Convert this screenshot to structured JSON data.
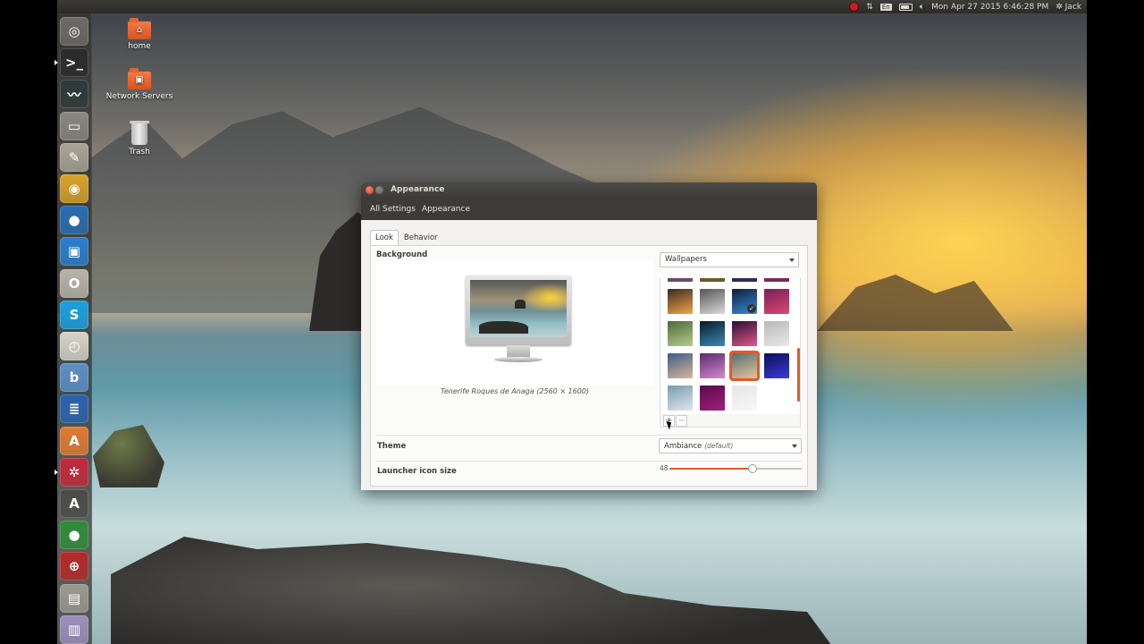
{
  "top_panel": {
    "keyboard": "En",
    "datetime": "Mon Apr 27 2015  6:46:28 PM",
    "user": "Jack",
    "icons": [
      "record-indicator-icon",
      "network-arrows-icon",
      "keyboard-layout-icon",
      "battery-icon",
      "volume-icon",
      "gear-icon"
    ]
  },
  "launcher": {
    "items": [
      {
        "name": "dash-home",
        "glyph": "◎",
        "color": "#6c6b67",
        "pip": false
      },
      {
        "name": "terminal",
        "glyph": ">_",
        "color": "#2b2b2b",
        "pip": true
      },
      {
        "name": "system-monitor",
        "glyph": "〰",
        "color": "#2f3a3a",
        "pip": false
      },
      {
        "name": "files",
        "glyph": "▭",
        "color": "#8a8780",
        "pip": false
      },
      {
        "name": "text-editor",
        "glyph": "✎",
        "color": "#a8a396",
        "pip": false
      },
      {
        "name": "chrome",
        "glyph": "◉",
        "color": "#d9a22b",
        "pip": false
      },
      {
        "name": "browser",
        "glyph": "●",
        "color": "#2a6db3",
        "pip": false
      },
      {
        "name": "remote-desktop",
        "glyph": "▣",
        "color": "#2b7fcf",
        "pip": false
      },
      {
        "name": "opera",
        "glyph": "O",
        "color": "#b8b4ab",
        "pip": false
      },
      {
        "name": "skype",
        "glyph": "S",
        "color": "#1aa1e0",
        "pip": false
      },
      {
        "name": "clock",
        "glyph": "◴",
        "color": "#d8d4c8",
        "pip": false
      },
      {
        "name": "b-app",
        "glyph": "b",
        "color": "#5e8fc7",
        "pip": false
      },
      {
        "name": "document-viewer",
        "glyph": "≣",
        "color": "#2a63b0",
        "pip": false
      },
      {
        "name": "software-center",
        "glyph": "A",
        "color": "#e07a30",
        "pip": false
      },
      {
        "name": "system-settings",
        "glyph": "✲",
        "color": "#c3283b",
        "pip": true
      },
      {
        "name": "update-manager",
        "glyph": "A",
        "color": "#4c4b48",
        "pip": false
      },
      {
        "name": "globe-app",
        "glyph": "●",
        "color": "#2f8c3a",
        "pip": false
      },
      {
        "name": "screenshot-tool",
        "glyph": "⊕",
        "color": "#b52727",
        "pip": false
      },
      {
        "name": "drive",
        "glyph": "▤",
        "color": "#9b9890",
        "pip": false
      },
      {
        "name": "printer",
        "glyph": "▥",
        "color": "#9d8fba",
        "pip": false
      }
    ]
  },
  "desktop": {
    "icons": [
      {
        "label": "home"
      },
      {
        "label": "Network Servers"
      },
      {
        "label": "Trash"
      }
    ]
  },
  "window": {
    "title": "Appearance",
    "breadcrumbs": [
      "All Settings",
      "Appearance"
    ],
    "tabs": [
      "Look",
      "Behavior"
    ],
    "background_label": "Background",
    "wallpaper_source": "Wallpapers",
    "caption": "Tenerife Roques de Anaga (2560 × 1600)",
    "wallpapers": [
      {
        "colors": [
          "#3a2a1f",
          "#f4a64a"
        ]
      },
      {
        "colors": [
          "#555555",
          "#d9d9d9"
        ]
      },
      {
        "colors": [
          "#0e1f3a",
          "#3a8bd8"
        ]
      },
      {
        "colors": [
          "#7a1e5a",
          "#d9496f"
        ]
      },
      {
        "colors": [
          "#4d6a3a",
          "#b6cc8f"
        ]
      },
      {
        "colors": [
          "#0a1a2a",
          "#3d8ab5"
        ]
      },
      {
        "colors": [
          "#2a0f2f",
          "#e05a8f"
        ]
      },
      {
        "colors": [
          "#b9b9b9",
          "#e8e8e8"
        ]
      },
      {
        "colors": [
          "#3b5c86",
          "#d8b89a"
        ]
      },
      {
        "colors": [
          "#5a2a6a",
          "#d48ad0"
        ]
      },
      {
        "colors": [
          "#5a6c74",
          "#e3c59a"
        ]
      },
      {
        "colors": [
          "#0b0f5a",
          "#3a3ad8"
        ]
      },
      {
        "colors": [
          "#7a9ab0",
          "#dfe8ee"
        ]
      },
      {
        "colors": [
          "#5a0a4a",
          "#a0207a"
        ]
      },
      {
        "colors": [
          "#e6e6e6",
          "#f7f7f7"
        ]
      }
    ],
    "selected_wallpaper_index": 10,
    "checked_wallpaper_index": 2,
    "add_button": "+",
    "remove_button": "−",
    "theme_label": "Theme",
    "theme_value": "Ambiance",
    "theme_suffix": "(default)",
    "launcher_size_label": "Launcher icon size",
    "launcher_size_value": "48",
    "launcher_size_fraction": 0.62
  },
  "colors": {
    "accent": "#e05a2b",
    "panel": "#3c3b37"
  }
}
